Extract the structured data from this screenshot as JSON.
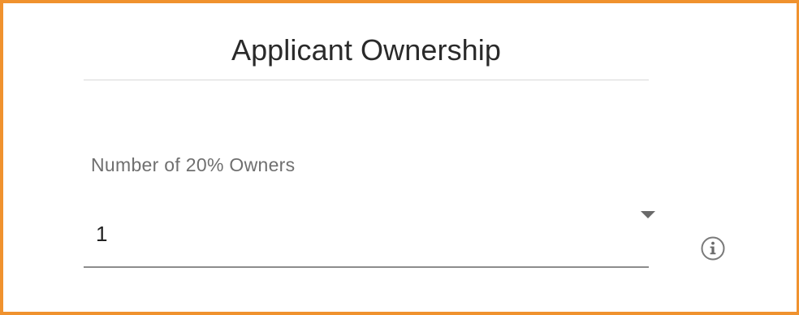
{
  "section": {
    "title": "Applicant Ownership"
  },
  "ownership_field": {
    "label": "Number of 20% Owners",
    "selected_value": "1",
    "dropdown_icon": "caret-down-icon",
    "info_icon": "info-icon"
  },
  "colors": {
    "frame_border": "#f0922e",
    "title_text": "#2a2a2a",
    "label_text": "#6f6f6f",
    "underline": "#8c8c8c"
  }
}
